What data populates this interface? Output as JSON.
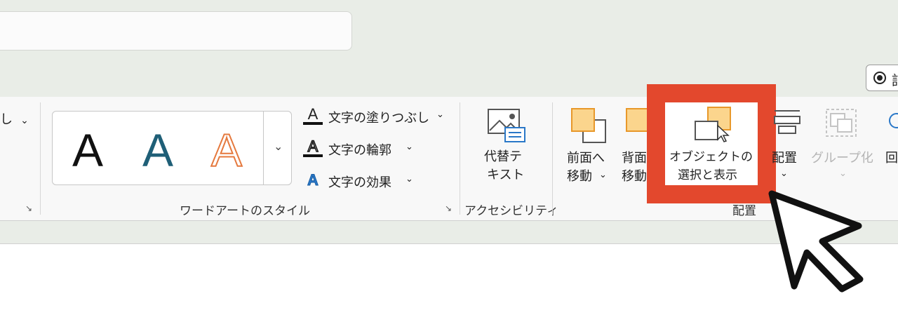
{
  "header": {
    "search_value": ""
  },
  "mode_button": {
    "label": "記"
  },
  "ribbon": {
    "partial_left": {
      "label": "し",
      "chevron": "⌄"
    },
    "wordart": {
      "gallery_letter": "A",
      "more_glyph": "⌄",
      "text_fill": "文字の塗りつぶし",
      "text_outline": "文字の輪郭",
      "text_effects": "文字の効果",
      "group_label": "ワードアートのスタイル",
      "chevron": "⌄"
    },
    "accessibility": {
      "alt_text_line1": "代替テ",
      "alt_text_line2": "キスト",
      "group_label": "アクセシビリティ"
    },
    "arrange": {
      "bring_forward_line1": "前面へ",
      "bring_forward_line2": "移動",
      "send_backward_line1": "背面",
      "send_backward_line2": "移動",
      "selection_pane_line1": "オブジェクトの",
      "selection_pane_line2": "選択と表示",
      "align_label": "配置",
      "group_btn_label": "グループ化",
      "rotate_label": "回",
      "group_label": "配置",
      "chevron": "⌄"
    },
    "launcher_glyph": "↘"
  },
  "colors": {
    "highlight": "#e3482d",
    "shape_fill": "#fbd58d",
    "shape_border": "#e8982a",
    "wordart_blue": "#1f5f77",
    "wordart_orange": "#e5793e"
  }
}
